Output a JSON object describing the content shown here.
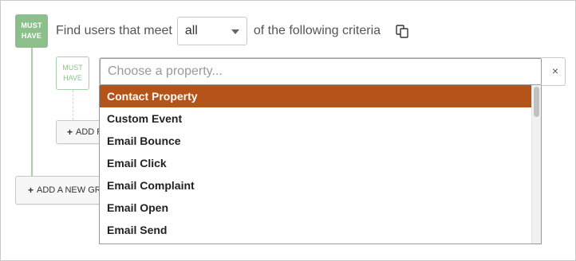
{
  "group": {
    "badge_line1": "MUST",
    "badge_line2": "HAVE",
    "criteria_prefix": "Find users that meet",
    "match_select_value": "all",
    "criteria_suffix": "of the following criteria",
    "copy_icon": "copy-icon"
  },
  "rule": {
    "badge_line1": "MUST",
    "badge_line2": "HAVE",
    "property_placeholder": "Choose a property...",
    "close_label": "×"
  },
  "buttons": {
    "add_rule": "ADD R",
    "add_group": "ADD A NEW GR"
  },
  "dropdown": {
    "options": [
      "Contact Property",
      "Custom Event",
      "Email Bounce",
      "Email Click",
      "Email Complaint",
      "Email Open",
      "Email Send"
    ],
    "selected_index": 0
  },
  "colors": {
    "badge_green": "#8dbf8d",
    "selected_option": "#b45418"
  }
}
